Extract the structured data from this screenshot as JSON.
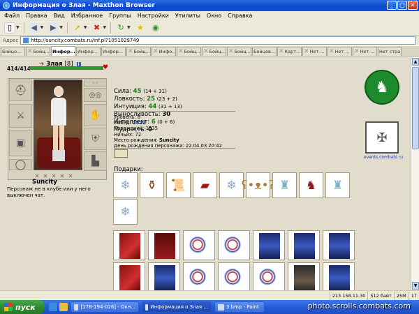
{
  "window": {
    "title": "Информация о Злая - Maxthon Browser"
  },
  "menu": [
    "Файл",
    "Правка",
    "Вид",
    "Избранное",
    "Группы",
    "Настройки",
    "Утилиты",
    "Окно",
    "Справка"
  ],
  "address": {
    "label": "Адрес",
    "url": "http://suncity.combats.ru/inf.pl?1051029749"
  },
  "tabs": [
    "Бойцо...",
    "Бойц...",
    "Инфор...",
    "Инфор...",
    "Инфор...",
    "Бойц...",
    "Инфо...",
    "Бойц...",
    "Бойц...",
    "Бойц...",
    "Бойцов...",
    "Карт...",
    "Нет ...",
    "Нет ...",
    "Нет ...",
    "Нет стра..."
  ],
  "active_tab": 2,
  "character": {
    "hp": "414/414",
    "hp_fraction": 1.0,
    "name": "Злая",
    "level": "[8]",
    "city": "Suncity",
    "status": "Персонаж не в клубе или у него выключен чат."
  },
  "stats": [
    {
      "label": "Сила:",
      "value": "45",
      "bonus": "(14 + 31)"
    },
    {
      "label": "Ловкость:",
      "value": "25",
      "bonus": "(23 + 2)"
    },
    {
      "label": "Интуиция:",
      "value": "44",
      "bonus": "(31 + 13)"
    },
    {
      "label": "Выносливость:",
      "value": "30",
      "bonus": ""
    },
    {
      "label": "Интеллект:",
      "value": "6",
      "bonus": "(0 + 6)"
    },
    {
      "label": "Мудрость:",
      "value": "0",
      "bonus": ""
    }
  ],
  "info": {
    "level": "Уровень: 8",
    "wins_label": "Побед:",
    "wins": "1522",
    "losses": "Поражений: 1535",
    "draws": "Ничьих: 72",
    "birthplace_label": "Место рождения:",
    "birthplace": "Suncity",
    "birthday": "День рождения персонажа: 22.04.03 20:42"
  },
  "gifts_label": "Подарки:",
  "gifts": [
    "snowflake",
    "pot",
    "scroll",
    "chest",
    "snowflake",
    "teddy-bear",
    "candle",
    "rocking-horse",
    "candle",
    "snowflake"
  ],
  "events_link": "events.combats.ru",
  "statusbar": {
    "ip": "213.158.11.30",
    "speed": "512 байт",
    "memory": "25M",
    "num": "17"
  },
  "taskbar": {
    "start": "пуск",
    "tasks": [
      "[178-194-026] - Окн...",
      "Информация о Злая ...",
      "3.bmp - Paint"
    ],
    "watermark": "photo.scrolls.combats.com"
  }
}
